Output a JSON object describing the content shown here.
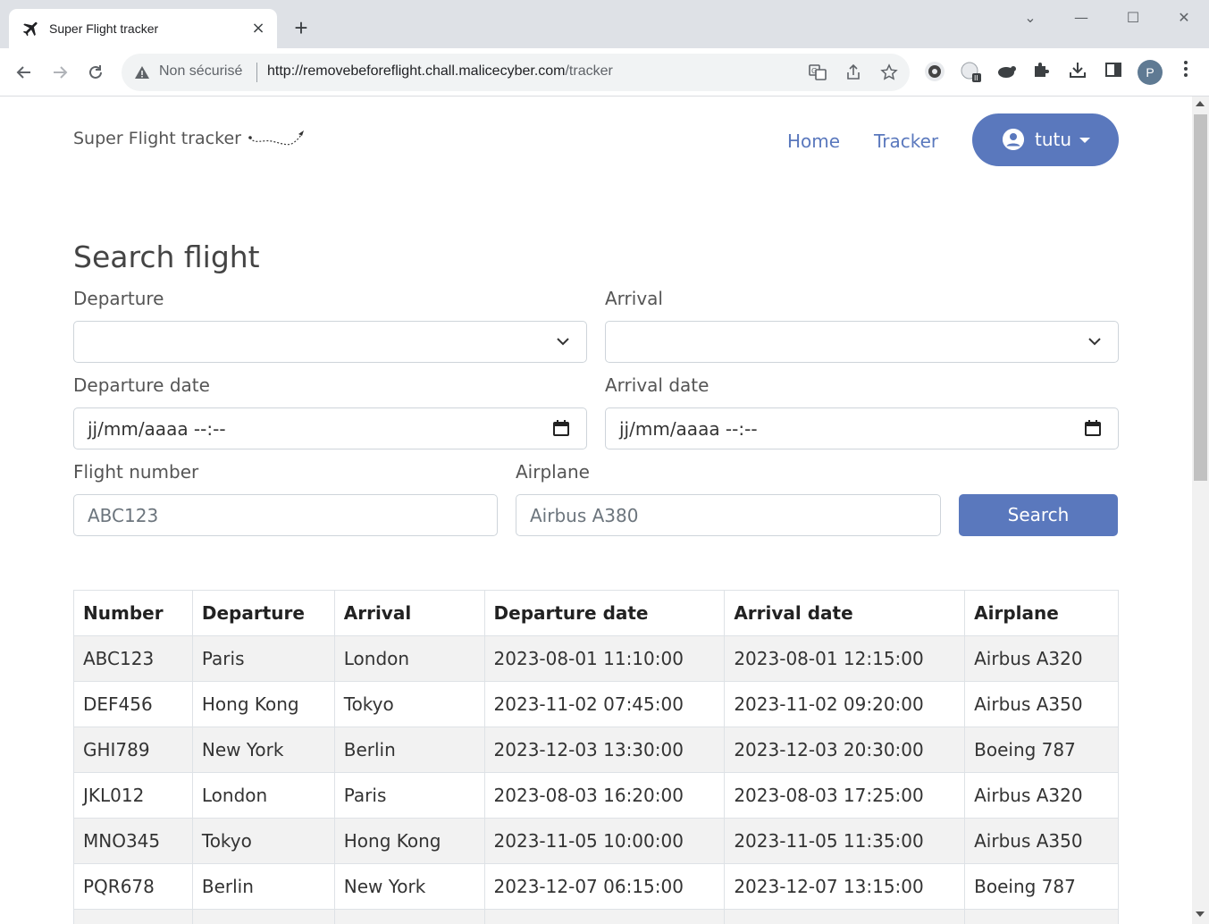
{
  "browser": {
    "tab_title": "Super Flight tracker",
    "tab_close": "×",
    "new_tab": "+",
    "window_controls": {
      "dropdown": "⌄",
      "minimize": "—",
      "maximize": "☐",
      "close": "✕"
    },
    "omnibox": {
      "security_label": "Non sécurisé",
      "url_host": "http://removebeforeflight.chall.malicecyber.com",
      "url_path": "/tracker"
    },
    "profile_initial": "P"
  },
  "header": {
    "brand": "Super Flight tracker",
    "nav": {
      "home": "Home",
      "tracker": "Tracker"
    },
    "user": "tutu"
  },
  "search": {
    "title": "Search flight",
    "departure_label": "Departure",
    "departure_value": "",
    "arrival_label": "Arrival",
    "arrival_value": "",
    "departure_date_label": "Departure date",
    "departure_date_value": "jj/mm/aaaa --:--",
    "arrival_date_label": "Arrival date",
    "arrival_date_value": "jj/mm/aaaa --:--",
    "flight_number_label": "Flight number",
    "flight_number_placeholder": "ABC123",
    "airplane_label": "Airplane",
    "airplane_placeholder": "Airbus A380",
    "button": "Search"
  },
  "table": {
    "headers": [
      "Number",
      "Departure",
      "Arrival",
      "Departure date",
      "Arrival date",
      "Airplane"
    ],
    "rows": [
      [
        "ABC123",
        "Paris",
        "London",
        "2023-08-01 11:10:00",
        "2023-08-01 12:15:00",
        "Airbus A320"
      ],
      [
        "DEF456",
        "Hong Kong",
        "Tokyo",
        "2023-11-02 07:45:00",
        "2023-11-02 09:20:00",
        "Airbus A350"
      ],
      [
        "GHI789",
        "New York",
        "Berlin",
        "2023-12-03 13:30:00",
        "2023-12-03 20:30:00",
        "Boeing 787"
      ],
      [
        "JKL012",
        "London",
        "Paris",
        "2023-08-03 16:20:00",
        "2023-08-03 17:25:00",
        "Airbus A320"
      ],
      [
        "MNO345",
        "Tokyo",
        "Hong Kong",
        "2023-11-05 10:00:00",
        "2023-11-05 11:35:00",
        "Airbus A350"
      ],
      [
        "PQR678",
        "Berlin",
        "New York",
        "2023-12-07 06:15:00",
        "2023-12-07 13:15:00",
        "Boeing 787"
      ],
      [
        "",
        "",
        "",
        "",
        "",
        ""
      ]
    ]
  },
  "icons": {
    "tab": "airplane-icon",
    "back": "arrow-left-icon",
    "forward": "arrow-right-icon",
    "reload": "reload-icon",
    "warning": "warning-triangle-icon",
    "translate": "translate-icon",
    "share": "share-icon",
    "bookmark": "star-icon",
    "extensions": [
      "gear-extension-icon",
      "globe-extension-icon",
      "turtle-extension-icon",
      "puzzle-icon"
    ],
    "download": "download-icon",
    "sidepanel": "side-panel-icon",
    "menu": "kebab-menu-icon"
  },
  "colors": {
    "accent": "#5a78bd",
    "tabbar": "#dee1e6",
    "table_stripe": "#f2f2f2"
  }
}
